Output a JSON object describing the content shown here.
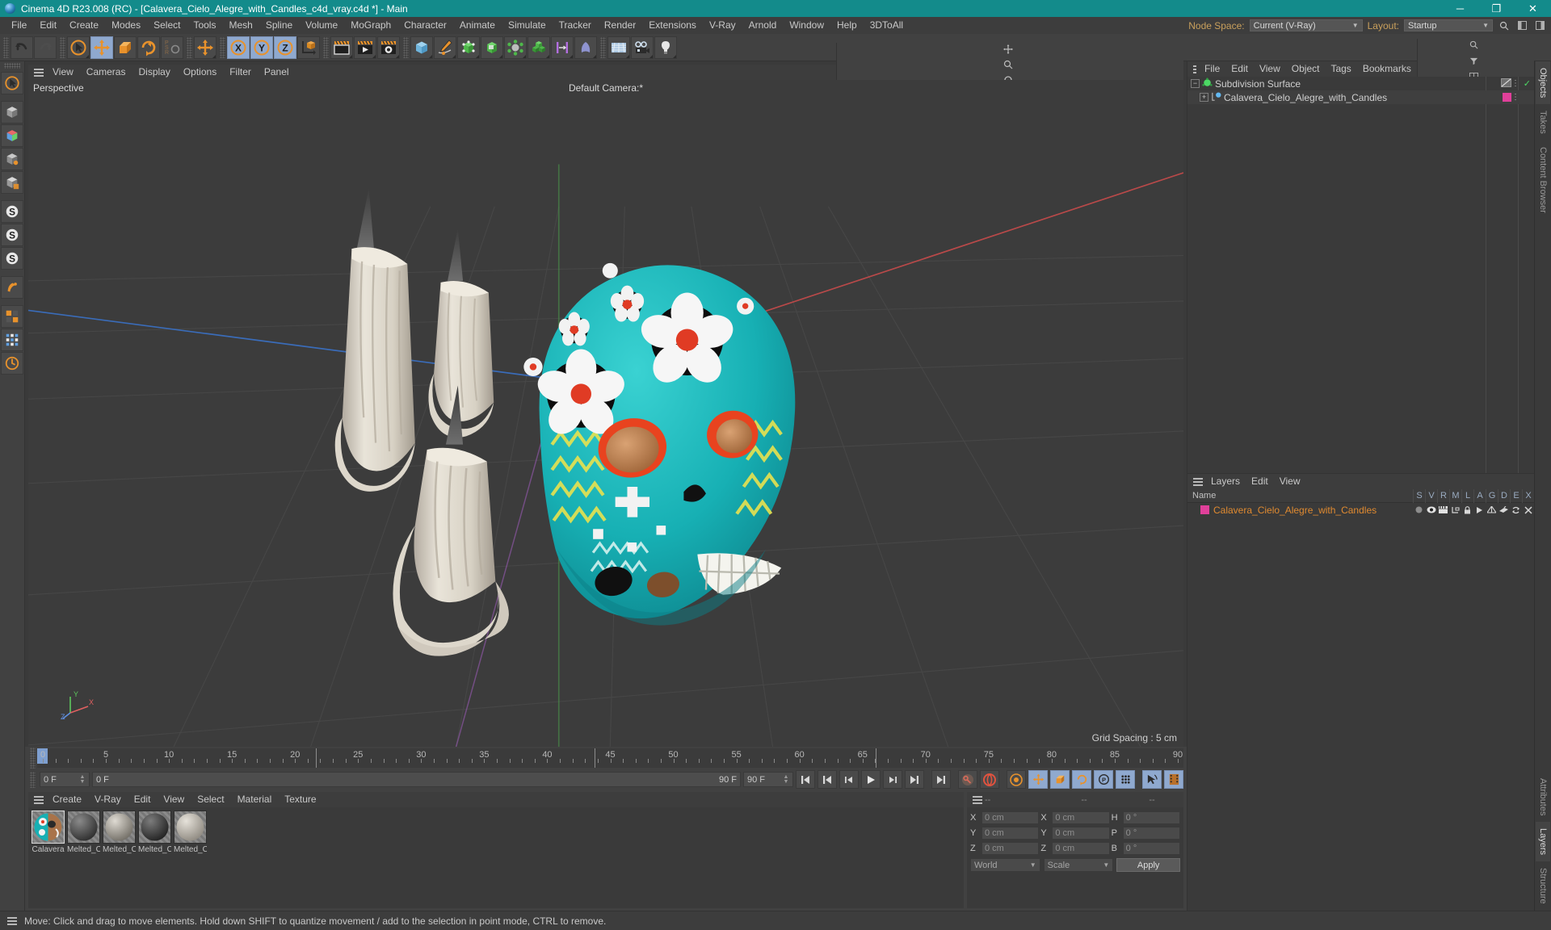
{
  "window": {
    "title": "Cinema 4D R23.008 (RC) - [Calavera_Cielo_Alegre_with_Candles_c4d_vray.c4d *] - Main",
    "minimize": "─",
    "maximize": "❐",
    "close": "✕",
    "titlebar_color": "#138b8b"
  },
  "menubar": {
    "items": [
      "File",
      "Edit",
      "Create",
      "Modes",
      "Select",
      "Tools",
      "Mesh",
      "Spline",
      "Volume",
      "MoGraph",
      "Character",
      "Animate",
      "Simulate",
      "Tracker",
      "Render",
      "Extensions",
      "V-Ray",
      "Arnold",
      "Window",
      "Help",
      "3DToAll"
    ],
    "node_space_label": "Node Space:",
    "node_space_value": "Current (V-Ray)",
    "layout_label": "Layout:",
    "layout_value": "Startup",
    "search_icon": "search-icon"
  },
  "toolbar": {
    "icons": [
      {
        "name": "undo-icon",
        "label": "Undo"
      },
      {
        "name": "redo-icon",
        "label": "Redo"
      },
      {
        "name": "select-live-icon",
        "label": "Live Selection"
      },
      {
        "name": "move-icon",
        "label": "Move"
      },
      {
        "name": "scale-icon",
        "label": "Scale"
      },
      {
        "name": "rotate-icon",
        "label": "Rotate"
      },
      {
        "name": "psr-icon",
        "label": "PSR"
      },
      {
        "name": "axis-move-icon",
        "label": "Move Axis"
      },
      {
        "name": "axis-x-icon",
        "label": "X Axis"
      },
      {
        "name": "axis-y-icon",
        "label": "Y Axis"
      },
      {
        "name": "axis-z-icon",
        "label": "Z Axis"
      },
      {
        "name": "world-axis-icon",
        "label": "World/Object Axis"
      },
      {
        "name": "render-view-icon",
        "label": "Render View"
      },
      {
        "name": "render-picture-viewer-icon",
        "label": "Render to Picture Viewer"
      },
      {
        "name": "render-settings-icon",
        "label": "Render Settings"
      },
      {
        "name": "cube-primitive-icon",
        "label": "Add Cube Object"
      },
      {
        "name": "spline-pen-icon",
        "label": "Add Spline"
      },
      {
        "name": "generator-icon",
        "label": "Add Generator"
      },
      {
        "name": "deformer-icon",
        "label": "Add Deformer"
      },
      {
        "name": "scene-object-icon",
        "label": "Add Scene Object"
      },
      {
        "name": "mograph-icon",
        "label": "Add MoGraph Object"
      },
      {
        "name": "field-icon",
        "label": "Add Field"
      },
      {
        "name": "character-icon",
        "label": "Add Character Object"
      },
      {
        "name": "environment-icon",
        "label": "Add Environment"
      },
      {
        "name": "camera-icon",
        "label": "Add Camera"
      },
      {
        "name": "light-icon",
        "label": "Add Light"
      }
    ]
  },
  "lefttools": {
    "icons": [
      {
        "name": "live-selection-tool-icon"
      },
      {
        "name": "move-tool-icon"
      },
      {
        "name": "scale-tool-icon"
      },
      {
        "name": "rotate-tool-icon"
      },
      {
        "name": "model-mode-icon"
      },
      {
        "name": "object-mode-icon"
      },
      {
        "name": "texture-mode-icon"
      },
      {
        "name": "workplane-mode-icon"
      },
      {
        "name": "point-mode-icon"
      },
      {
        "name": "edge-mode-icon"
      },
      {
        "name": "polygon-mode-icon"
      },
      {
        "name": "enable-axis-icon"
      },
      {
        "name": "viewport-solo-icon"
      },
      {
        "name": "snap-icon"
      },
      {
        "name": "workplane-lock-icon"
      }
    ]
  },
  "viewport": {
    "menu": [
      "View",
      "Cameras",
      "Display",
      "Options",
      "Filter",
      "Panel"
    ],
    "view_label": "Perspective",
    "camera_label": "Default Camera:*",
    "grid_spacing": "Grid Spacing : 5 cm",
    "header_icons": [
      "pan-icon",
      "zoom-icon",
      "rotate-view-icon",
      "maximize-view-icon"
    ],
    "axis_labels": {
      "x": "X",
      "y": "Y",
      "z": "Z"
    }
  },
  "timeline": {
    "ticks": [
      0,
      5,
      10,
      15,
      20,
      25,
      30,
      35,
      40,
      45,
      50,
      55,
      60,
      65,
      70,
      75,
      80,
      85,
      90
    ],
    "current_frame": "0 F",
    "range_start": "0 F",
    "range_end": "90 F",
    "end_frame_field": "90 F",
    "fps_field": "0 F",
    "transport": [
      {
        "name": "goto-start-button",
        "glyph": "first"
      },
      {
        "name": "goto-previous-key-button",
        "glyph": "prevkey"
      },
      {
        "name": "step-back-button",
        "glyph": "stepback"
      },
      {
        "name": "play-button",
        "glyph": "play"
      },
      {
        "name": "step-forward-button",
        "glyph": "stepfwd"
      },
      {
        "name": "goto-next-key-button",
        "glyph": "nextkey"
      },
      {
        "name": "goto-end-button",
        "glyph": "last"
      }
    ],
    "record_tools": [
      {
        "name": "autokey-button"
      },
      {
        "name": "record-active-objects-button"
      },
      {
        "name": "keyframe-settings-button"
      },
      {
        "name": "position-key-button"
      },
      {
        "name": "scale-key-button"
      },
      {
        "name": "rotation-key-button"
      },
      {
        "name": "parameter-key-button"
      },
      {
        "name": "point-level-animation-button"
      },
      {
        "name": "animation-mode-button"
      },
      {
        "name": "timeline-view-button"
      }
    ]
  },
  "materials": {
    "menu": [
      "Create",
      "V-Ray",
      "Edit",
      "View",
      "Select",
      "Material",
      "Texture"
    ],
    "items": [
      {
        "name": "Calavera",
        "selected": true
      },
      {
        "name": "Melted_C",
        "selected": false
      },
      {
        "name": "Melted_C",
        "selected": false
      },
      {
        "name": "Melted_C",
        "selected": false
      },
      {
        "name": "Melted_C",
        "selected": false
      }
    ]
  },
  "coordinates": {
    "header_left": "--",
    "header_mid": "--",
    "header_right": "--",
    "position": [
      {
        "label": "X",
        "value": "0 cm"
      },
      {
        "label": "Y",
        "value": "0 cm"
      },
      {
        "label": "Z",
        "value": "0 cm"
      }
    ],
    "size": [
      {
        "label": "X",
        "value": "0 cm"
      },
      {
        "label": "Y",
        "value": "0 cm"
      },
      {
        "label": "Z",
        "value": "0 cm"
      }
    ],
    "rotation": [
      {
        "label": "H",
        "value": "0 °"
      },
      {
        "label": "P",
        "value": "0 °"
      },
      {
        "label": "B",
        "value": "0 °"
      }
    ],
    "coord_system": "World",
    "size_mode": "Scale",
    "apply_label": "Apply"
  },
  "object_manager": {
    "menu": [
      "File",
      "Edit",
      "View",
      "Object",
      "Tags",
      "Bookmarks"
    ],
    "search_icon": "search-icon",
    "rows": [
      {
        "name": "Subdivision Surface",
        "indent": 0,
        "icon": "subdivision-surface-icon",
        "tag": "display-tag",
        "check": true
      },
      {
        "name": "Calavera_Cielo_Alegre_with_Candles",
        "indent": 1,
        "icon": "polygon-object-icon",
        "tag": "material-tag",
        "check": false
      }
    ]
  },
  "layer_manager": {
    "menu": [
      "Layers",
      "Edit",
      "View"
    ],
    "columns": [
      "Name",
      "S",
      "V",
      "R",
      "M",
      "L",
      "A",
      "G",
      "D",
      "E",
      "X"
    ],
    "rows": [
      {
        "name": "Calavera_Cielo_Alegre_with_Candles",
        "color": "#e0409a"
      }
    ]
  },
  "vtabs_top": [
    "Objects",
    "Takes",
    "Content Browser"
  ],
  "vtabs_bottom": [
    "Attributes",
    "Layers",
    "Structure"
  ],
  "statusbar": {
    "message": "Move: Click and drag to move elements. Hold down SHIFT to quantize movement / add to the selection in point mode, CTRL to remove."
  },
  "colors": {
    "accent_teal": "#138b8b",
    "highlight_blue": "#8fa9cf",
    "orange": "#e08a30",
    "layer_pink": "#e0409a"
  }
}
